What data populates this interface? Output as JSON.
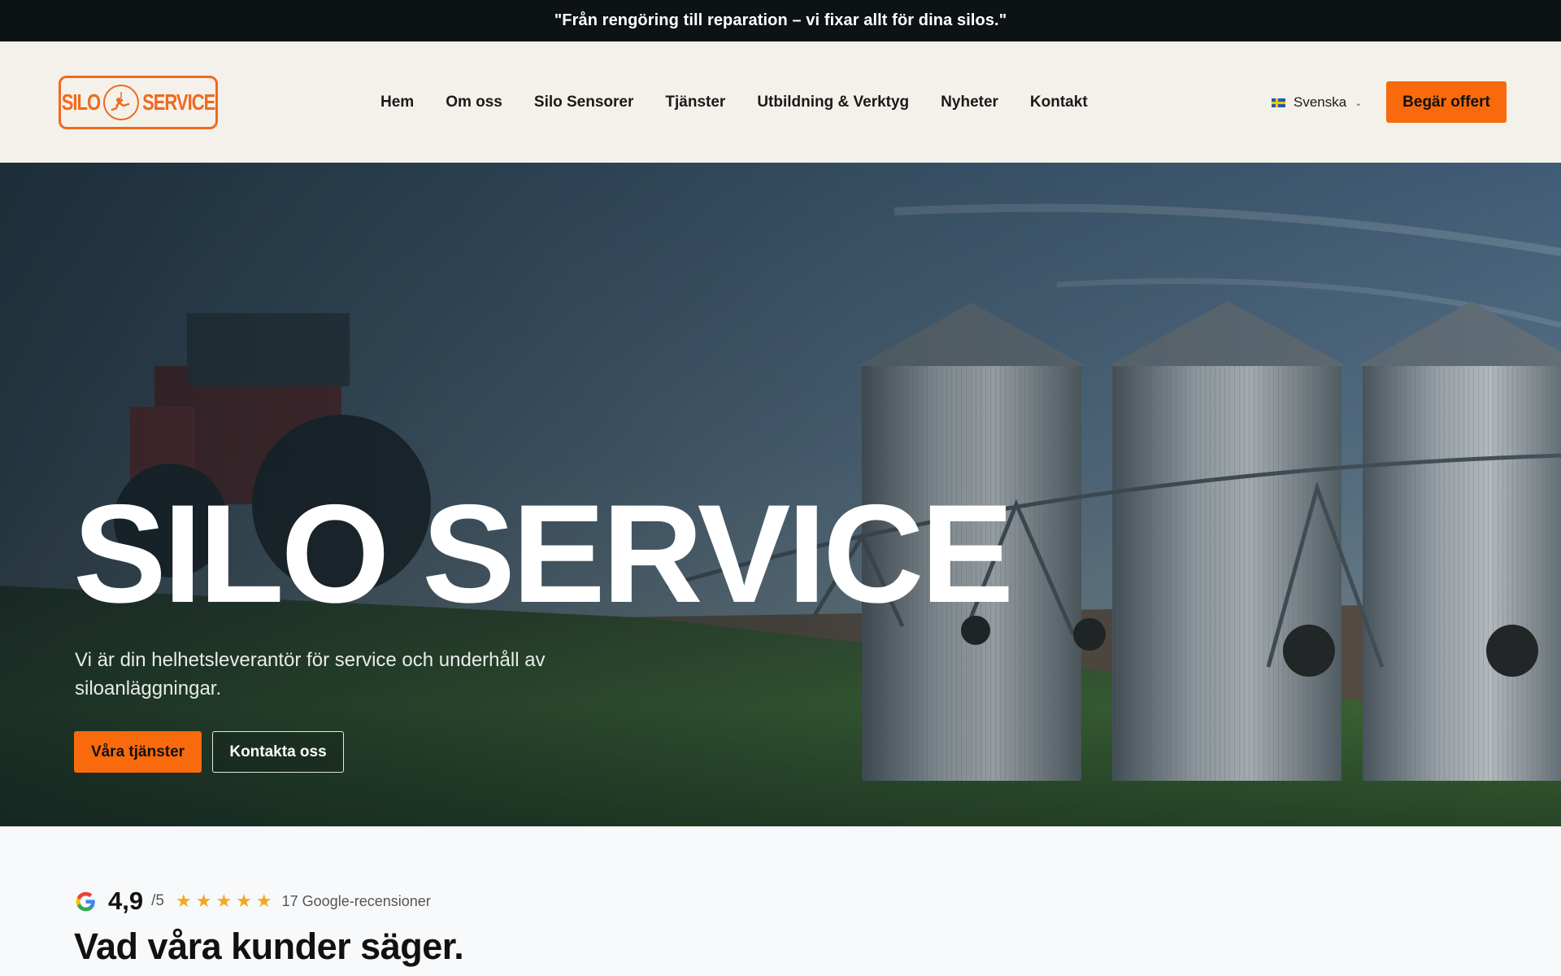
{
  "announcement": {
    "text": "\"Från rengöring till reparation – vi fixar allt för dina silos.\""
  },
  "header": {
    "logo": {
      "left_word": "SILO",
      "right_word": "SERVICE"
    },
    "nav": [
      {
        "label": "Hem"
      },
      {
        "label": "Om oss"
      },
      {
        "label": "Silo Sensorer"
      },
      {
        "label": "Tjänster"
      },
      {
        "label": "Utbildning & Verktyg"
      },
      {
        "label": "Nyheter"
      },
      {
        "label": "Kontakt"
      }
    ],
    "language": {
      "label": "Svenska",
      "flag": "swedish-flag-icon"
    },
    "cta_label": "Begär offert"
  },
  "hero": {
    "title": "SILO SERVICE",
    "subtitle": "Vi är din helhetsleverantör för service och underhåll av siloanläggningar.",
    "primary_button": "Våra tjänster",
    "secondary_button": "Kontakta oss"
  },
  "reviews": {
    "score": "4,9",
    "score_max": "/5",
    "stars": 5,
    "count_label": "17 Google-recensioner",
    "heading": "Vad våra kunder säger."
  },
  "colors": {
    "accent": "#f96a0d",
    "logo_orange": "#f06a1e",
    "topbar_bg": "#0d1214",
    "header_bg": "#f4f1eb"
  }
}
